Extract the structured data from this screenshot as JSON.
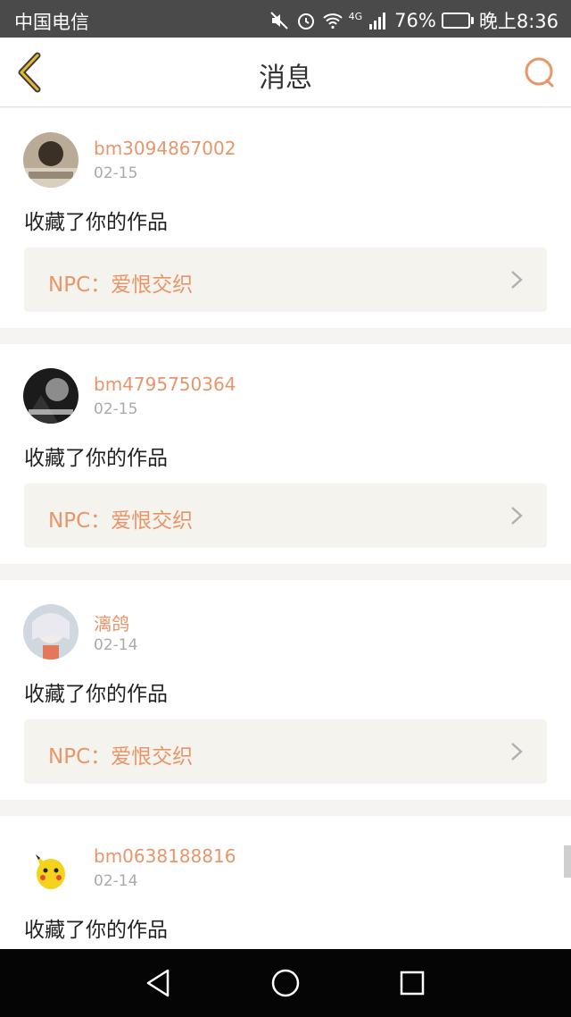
{
  "status_bar": {
    "carrier": "中国电信",
    "network": "4G",
    "battery": "76%",
    "battery_level": 0.76,
    "time": "晚上8:36"
  },
  "header": {
    "title": "消息",
    "back_icon": "back-chevron-icon",
    "search_icon": "search-icon"
  },
  "notifications": [
    {
      "username": "bm3094867002",
      "date": "02-15",
      "message": "收藏了你的作品",
      "work_label": "NPC：爱恨交织"
    },
    {
      "username": "bm4795750364",
      "date": "02-15",
      "message": "收藏了你的作品",
      "work_label": "NPC：爱恨交织"
    },
    {
      "username": "漓鸽",
      "date": "02-14",
      "message": "收藏了你的作品",
      "work_label": "NPC：爱恨交织"
    },
    {
      "username": "bm0638188816",
      "date": "02-14",
      "message": "收藏了你的作品"
    }
  ],
  "colors": {
    "accent": "#e8956a",
    "back_icon": "#d4a017",
    "statusbar": "#4a4a4a",
    "navbar": "#050505",
    "card_link_bg": "#f4f3ee"
  }
}
